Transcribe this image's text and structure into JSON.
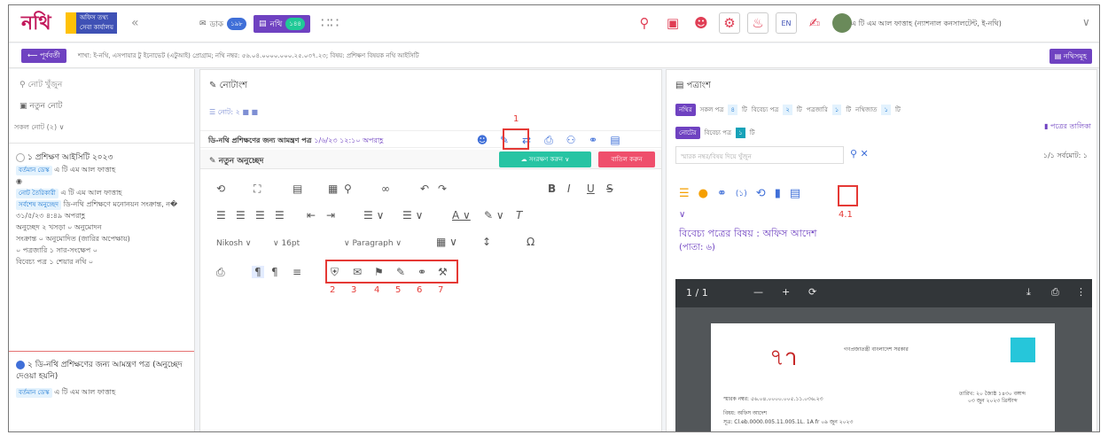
{
  "app": {
    "logo_text": "নথি",
    "logo_sub": "অফিস তথ্য সেবা কার্যালয়"
  },
  "topnav": {
    "dak_label": "ডাক",
    "dak_count": "১৯৮",
    "nothi_label": "নথি",
    "nothi_count": "১৪৪",
    "lang": "EN",
    "user_name": "এ টি এম আল ফাত্তাহ (ন্যাশনাল কনসালটেন্ট, ই-নথি)"
  },
  "crumb": {
    "back_label": "পূর্ববর্তী",
    "path_text": "শাখা: ই-নথি, এসপায়ার টু ইনোভেট (এটুআই) প্রোগ্রাম; নথি নম্বর: ৫৬.০৪.০০০০.০০০.২৫.০৩৭.২৩; বিষয়: প্রশিক্ষণ বিষয়ক নথি আইসিটি",
    "all_nothi_label": "নথিসমূহ"
  },
  "sidebar": {
    "search_placeholder": "নোট খুঁজুন",
    "new_note": "নতুন নোট",
    "all_notes": "সকল নোট (২)",
    "note1": {
      "title": "১ প্রশিক্ষণ আইসিটি ২০২৩",
      "current_desk_label": "বর্তমান ডেস্ক",
      "current_desk_value": "এ টি এম আল ফাত্তাহ",
      "creator_label": "নোট তৈরিকারী",
      "creator_value": "এ টি এম আল ফাত্তাহ",
      "last_approve_label": "সর্বশেষ অনুচ্ছেদ",
      "last_approve_value": "ডি-নথি প্রশিক্ষণে মনোনয়ন সংক্রান্ত, ন�",
      "datetime": "৩১/৫/২৩ ৪:৪৯ অপরাহ্ণ",
      "counts_line1": "অনুচ্ছেদ ২ খসড়া ০ অনুমোদন",
      "counts_line2": "সংক্রান্ত ০ অনুমোদিত (জারির অপেক্ষায়)",
      "counts_line3": "০ পত্রজারি ১ সার-সংক্ষেপ ০",
      "counts_line4": "বিবেচ্য পত্র ১ শেয়ার নথি ০"
    },
    "note2": {
      "title": "২ ডি-নথি প্রশিক্ষণের জন্য আমন্ত্রণ পত্র (অনুচ্ছেদ দেওয়া হয়নি)",
      "current_desk_label": "বর্তমান ডেস্ক",
      "current_desk_value": "এ টি এম আল ফাত্তাহ"
    }
  },
  "middle": {
    "header": "নোটাংশ",
    "note_tab": "নোট: ২",
    "note_title": "ডি-নথি প্রশিক্ষণের জন্য আমন্ত্রণ পত্র",
    "note_date": "১/৬/২৩ ১২:১০ অপরাহ্ণ",
    "new_para": "নতুন অনুচ্ছেদ",
    "save_label": "সংরক্ষণ করুন",
    "cancel_label": "বাতিল করুন",
    "font_name": "Nikosh",
    "font_size": "16pt",
    "paragraph": "Paragraph",
    "annotations": [
      "1",
      "2",
      "3",
      "4",
      "5",
      "6",
      "7"
    ]
  },
  "right": {
    "header": "পত্রাংশ",
    "nothi_tag": "নথির",
    "all_potro": "সকল পত্র",
    "all_potro_n": "৪",
    "ti": "টি",
    "bibechyo": "বিবেচ্য পত্র",
    "bibechyo_n": "২",
    "potrojari": "পত্রজারি",
    "potrojari_n": "১",
    "nothijat": "নথিজাত",
    "nothijat_n": "১",
    "note_tag": "নোটের",
    "note_bibechyo": "বিবেচ্য পত্র",
    "note_bibechyo_n": "১",
    "potro_list": "পত্রের তালিকা",
    "search_placeholder": "স্মারক নম্বর/বিষয় দিয়ে খুঁজুন",
    "page_info": "১/১ সর্বমোট: ১",
    "attach_count": "(১)",
    "annot": "4.1",
    "subject": "বিবেচ্য পত্রের বিষয় : অফিস আদেশ",
    "page": "(পাতা: ৬)",
    "pdf_page": "1 / 1",
    "pdf_header": "গণপ্রজাতন্ত্রী বাংলাদেশ সরকার",
    "pdf_smarok": "স্মারক নম্বর: ৫৬.০৪.০০০০.০০৫.১১.০৩৬.২৩",
    "pdf_subject": "বিষয়: অফিস আদেশ",
    "pdf_ref": "সূত্র: Cl.eb.0000.005.11.005.1L. 1A fr ০৯ জুন ২০২৩",
    "pdf_date": "তারিখ: ২০ জ্যৈষ্ঠ ১৪৩০ বঙ্গাব্দ",
    "pdf_date2": "০৩ জুন ২০২৩ খ্রিস্টাব্দ"
  }
}
